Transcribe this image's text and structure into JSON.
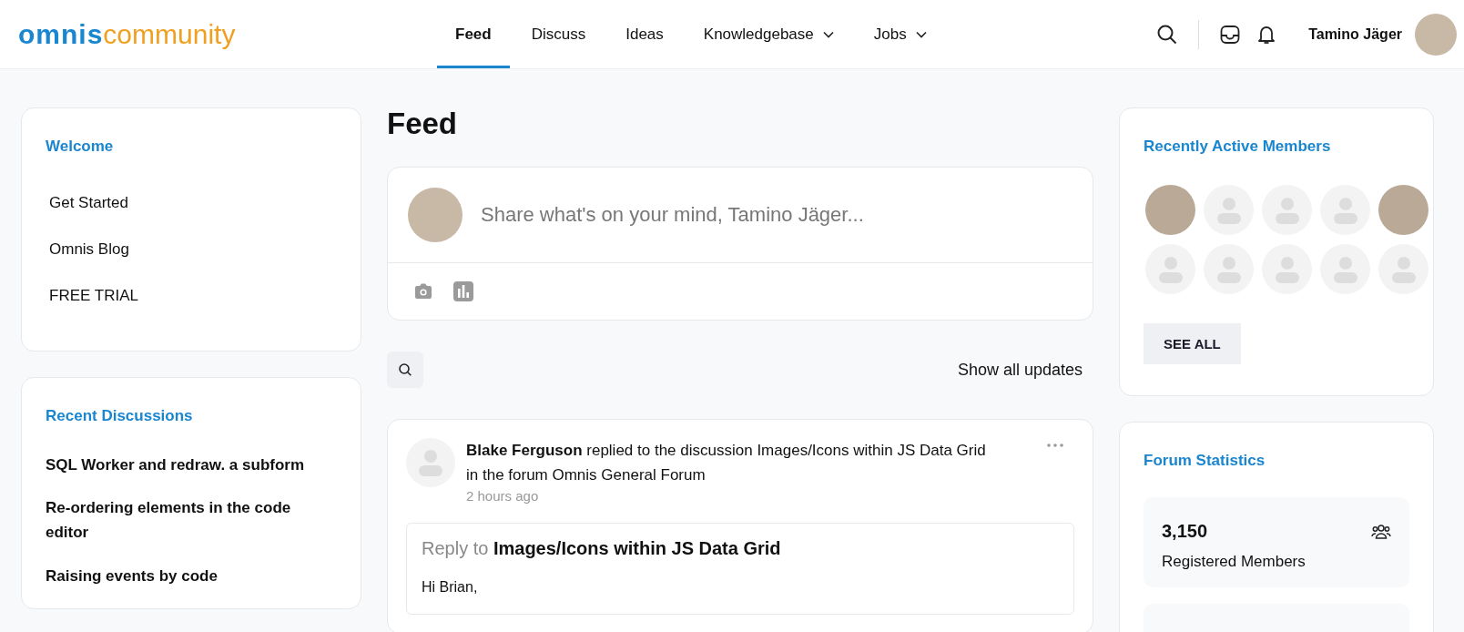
{
  "logo": {
    "brand": "omnis",
    "suffix": "community"
  },
  "nav": [
    {
      "label": "Feed",
      "selected": true,
      "dropdown": false
    },
    {
      "label": "Discuss",
      "selected": false,
      "dropdown": false
    },
    {
      "label": "Ideas",
      "selected": false,
      "dropdown": false
    },
    {
      "label": "Knowledgebase",
      "selected": false,
      "dropdown": true
    },
    {
      "label": "Jobs",
      "selected": false,
      "dropdown": true
    }
  ],
  "user": {
    "name": "Tamino Jäger"
  },
  "welcome": {
    "title": "Welcome",
    "links": [
      "Get Started",
      "Omnis Blog",
      "FREE TRIAL"
    ]
  },
  "recent_discussions": {
    "title": "Recent Discussions",
    "items": [
      "SQL Worker and redraw. a subform",
      "Re-ordering elements in the code editor",
      "Raising events by code"
    ]
  },
  "feed": {
    "title": "Feed",
    "composer": {
      "placeholder": "Share what's on your mind, Tamino Jäger..."
    },
    "filter": "Show all updates",
    "posts": [
      {
        "summary": "**Blake Ferguson** replied to the discussion Images/Icons within JS Data Grid in the forum Omnis General Forum",
        "time": "2 hours ago",
        "reply_heading": "Reply to **Images/Icons within JS Data Grid**",
        "body": "Hi Brian,"
      }
    ]
  },
  "members": {
    "title": "Recently Active Members",
    "avatars": [
      {
        "kind": "photo"
      },
      {
        "kind": "placeholder"
      },
      {
        "kind": "placeholder"
      },
      {
        "kind": "placeholder"
      },
      {
        "kind": "photo"
      },
      {
        "kind": "placeholder"
      },
      {
        "kind": "placeholder"
      },
      {
        "kind": "placeholder"
      },
      {
        "kind": "placeholder"
      },
      {
        "kind": "placeholder"
      }
    ],
    "button": "SEE ALL"
  },
  "stats": {
    "title": "Forum Statistics",
    "items": [
      {
        "value": "3,150",
        "label": "Registered Members"
      }
    ]
  }
}
